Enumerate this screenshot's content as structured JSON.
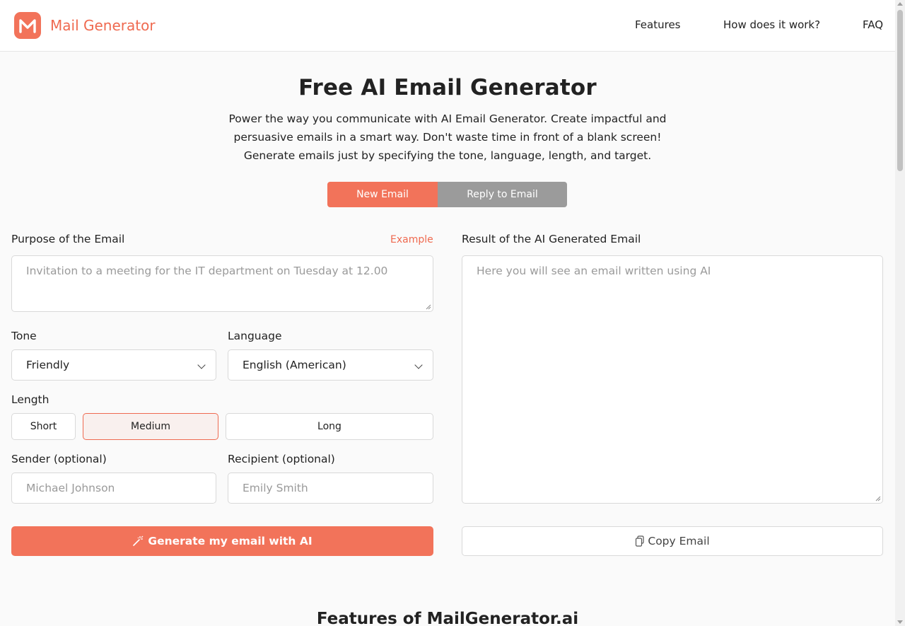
{
  "header": {
    "logo_text": "Mail Generator",
    "nav": {
      "features": "Features",
      "how": "How does it work?",
      "faq": "FAQ"
    }
  },
  "hero": {
    "title": "Free AI Email Generator",
    "description_lines": [
      "Power the way you communicate with AI Email Generator. Create impactful and",
      "persuasive emails in a smart way. Don't waste time in front of a blank screen!",
      "Generate emails just by specifying the tone, language, length, and target."
    ]
  },
  "mode_toggle": {
    "new_email": "New Email",
    "reply_email": "Reply to Email",
    "active": "new_email"
  },
  "form": {
    "purpose_label": "Purpose of the Email",
    "example_link": "Example",
    "purpose_placeholder": "Invitation to a meeting for the IT department on Tuesday at 12.00",
    "tone_label": "Tone",
    "tone_value": "Friendly",
    "language_label": "Language",
    "language_value": "English (American)",
    "length_label": "Length",
    "length_options": {
      "short": "Short",
      "medium": "Medium",
      "long": "Long"
    },
    "length_selected": "Medium",
    "sender_label": "Sender (optional)",
    "sender_placeholder": "Michael Johnson",
    "recipient_label": "Recipient (optional)",
    "recipient_placeholder": "Emily Smith",
    "generate_button": "Generate my email with AI"
  },
  "result": {
    "label": "Result of the AI Generated Email",
    "placeholder": "Here you will see an email written using AI",
    "copy_button": "Copy Email"
  },
  "features_section": {
    "title": "Features of MailGenerator.ai"
  },
  "colors": {
    "accent": "#f2735a",
    "accent_text": "#ef6a50",
    "inactive_toggle": "#9b9b9b",
    "background": "#fafafa"
  }
}
